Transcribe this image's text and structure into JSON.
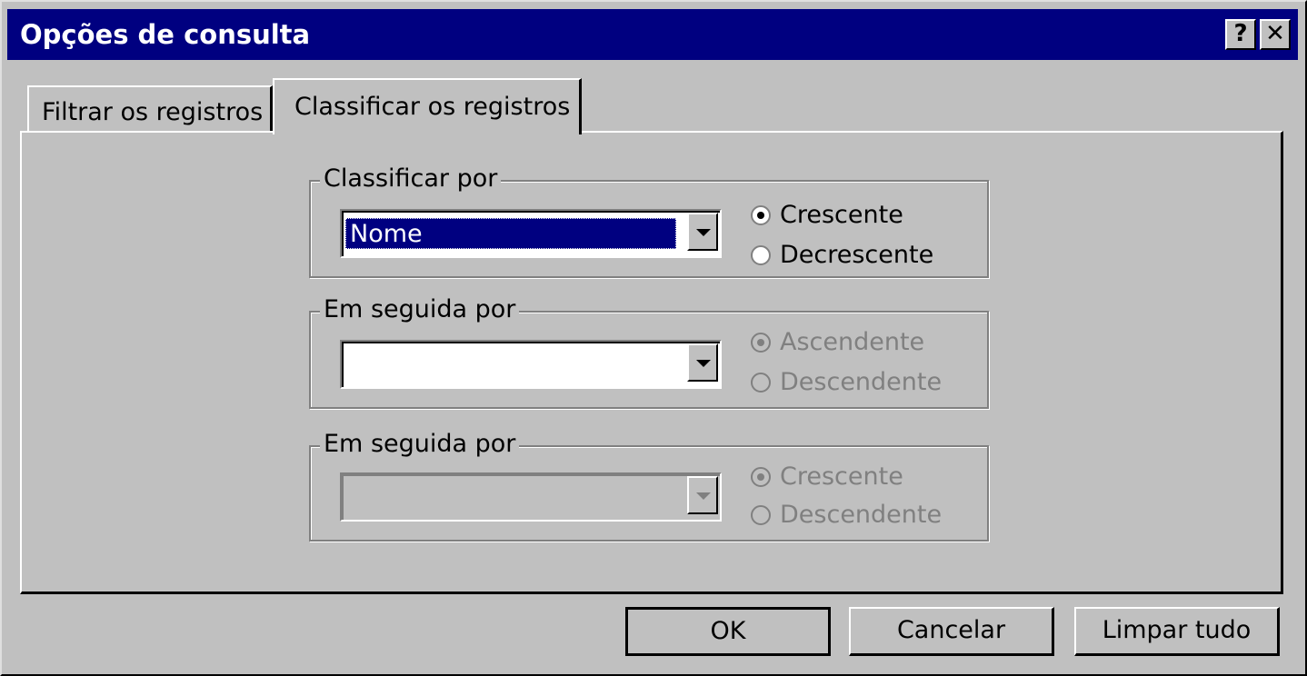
{
  "window": {
    "title": "Opções de consulta",
    "help_button": "?",
    "close_button": "✕"
  },
  "tabs": [
    {
      "label": "Filtrar os registros",
      "active": false
    },
    {
      "label": "Classificar os registros",
      "active": true
    }
  ],
  "sort_groups": [
    {
      "legend": "Classificar por",
      "value": "Nome",
      "enabled": true,
      "options": [
        {
          "label": "Crescente",
          "checked": true
        },
        {
          "label": "Decrescente",
          "checked": false
        }
      ]
    },
    {
      "legend": "Em seguida por",
      "value": "",
      "enabled": true,
      "options": [
        {
          "label": "Ascendente",
          "checked": true
        },
        {
          "label": "Descendente",
          "checked": false
        }
      ]
    },
    {
      "legend": "Em seguida por",
      "value": "",
      "enabled": false,
      "options": [
        {
          "label": "Crescente",
          "checked": true
        },
        {
          "label": "Descendente",
          "checked": false
        }
      ]
    }
  ],
  "buttons": {
    "ok": "OK",
    "cancel": "Cancelar",
    "clear_all": "Limpar tudo"
  }
}
